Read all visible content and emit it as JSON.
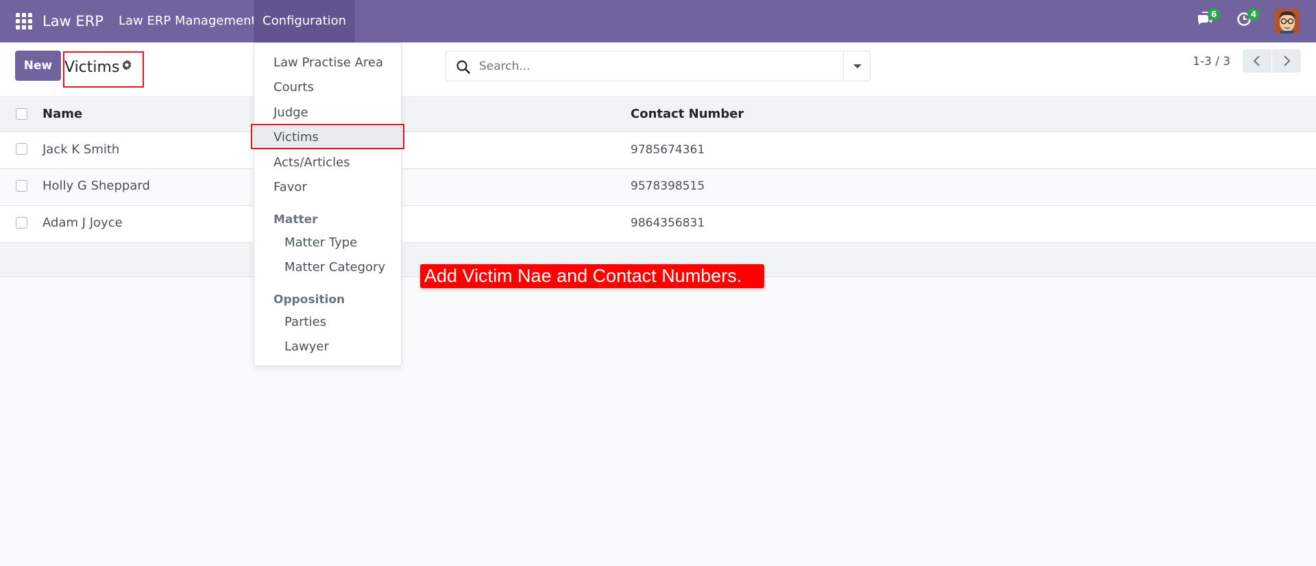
{
  "navbar": {
    "brand": "Law ERP",
    "menu": [
      "Law ERP Management",
      "Configuration"
    ],
    "chat_badge": "6",
    "activity_badge": "4"
  },
  "control_panel": {
    "new_label": "New",
    "title": "Victims",
    "search_placeholder": "Search...",
    "pager": "1-3 / 3"
  },
  "list": {
    "columns": [
      "Name",
      "Contact Number"
    ],
    "rows": [
      {
        "name": "Jack K Smith",
        "contact": "9785674361"
      },
      {
        "name": "Holly G Sheppard",
        "contact": "9578398515"
      },
      {
        "name": "Adam J Joyce",
        "contact": "9864356831"
      }
    ]
  },
  "dropdown": {
    "items": [
      "Law Practise Area",
      "Courts",
      "Judge",
      "Victims",
      "Acts/Articles",
      "Favor"
    ],
    "active": "Victims",
    "sections": [
      {
        "header": "Matter",
        "items": [
          "Matter Type",
          "Matter Category"
        ]
      },
      {
        "header": "Opposition",
        "items": [
          "Parties",
          "Lawyer"
        ]
      }
    ]
  },
  "annotation": "Add Victim Nae and Contact Numbers.",
  "colors": {
    "navbar": "#71639e",
    "annotation": "#ff0000",
    "highlight_box": "#e3131c",
    "badge": "#28a745"
  }
}
